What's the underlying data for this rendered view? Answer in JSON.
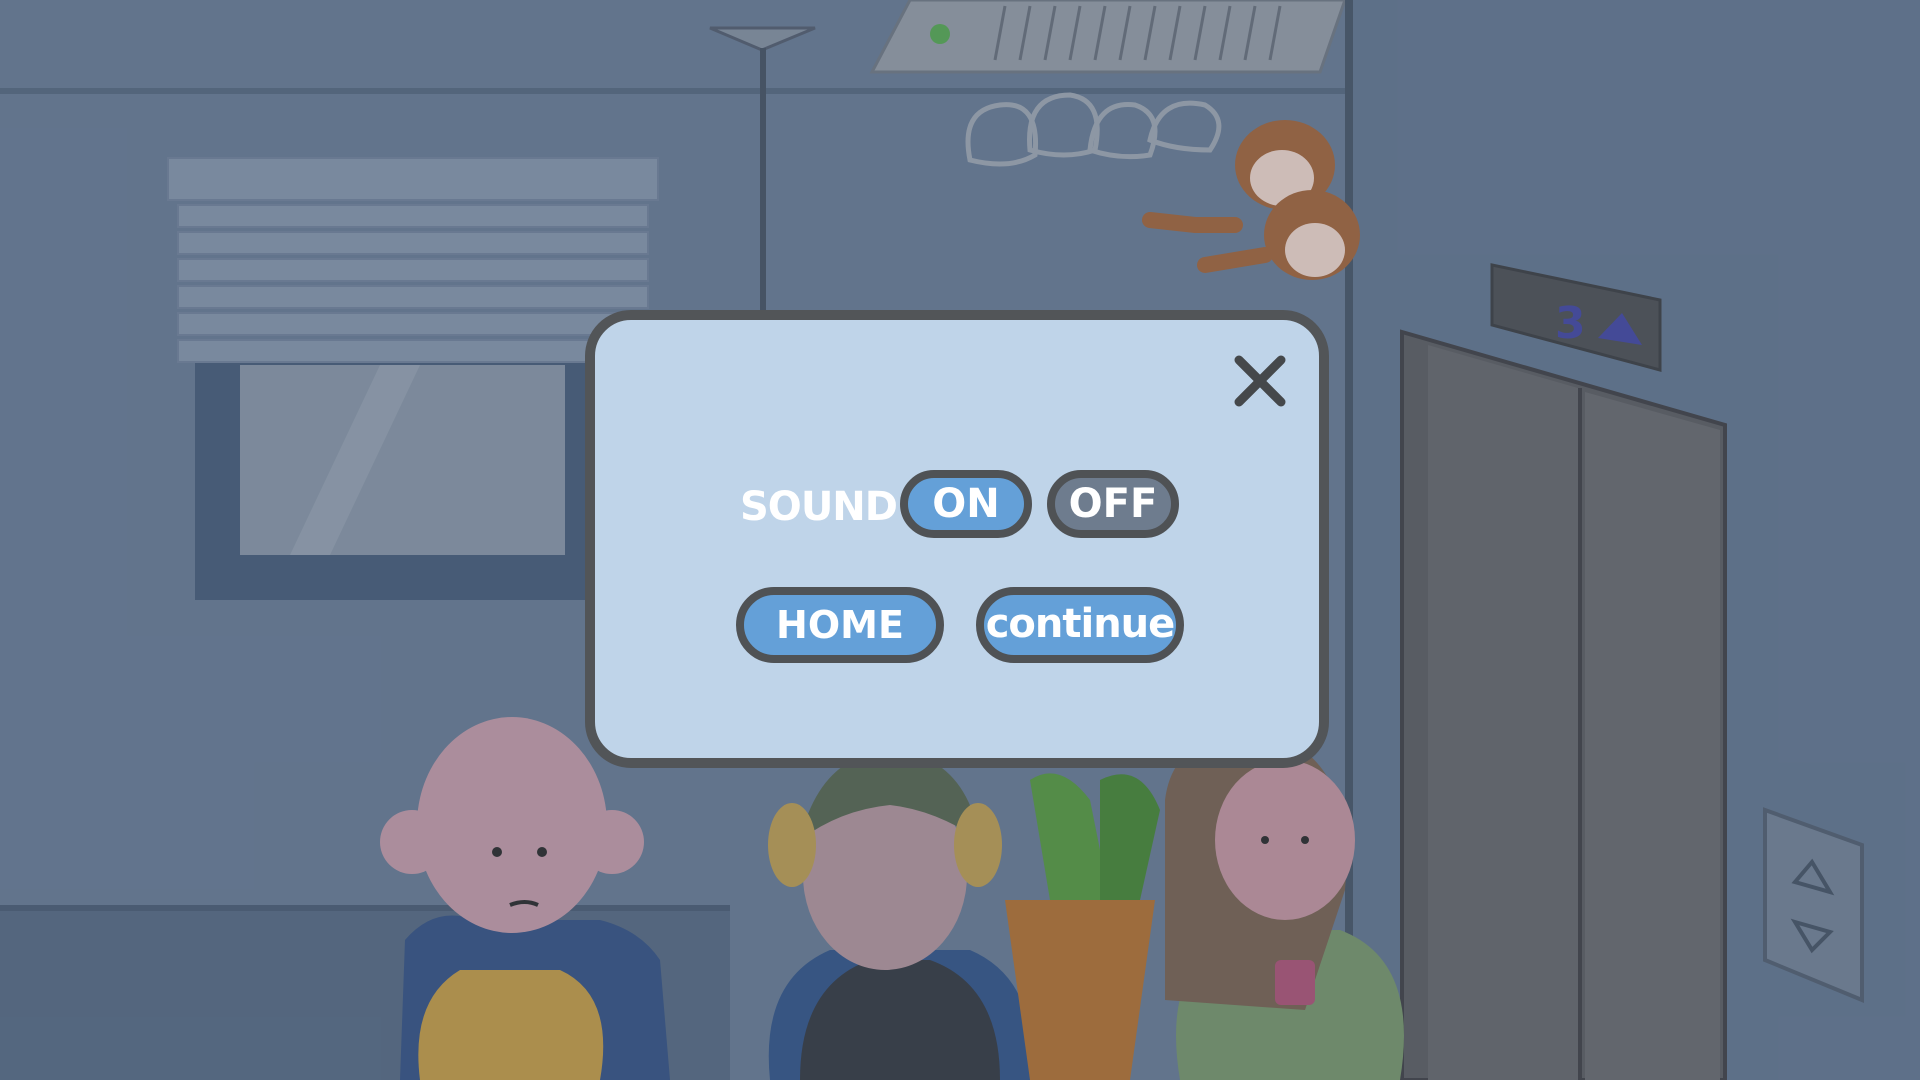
{
  "scene": {
    "elevator_floor_display": "3",
    "elevator_floor_arrow": "up-arrow-icon"
  },
  "dialog": {
    "close_icon": "close-icon",
    "sound_label": "SOUND",
    "sound_on_label": "ON",
    "sound_off_label": "OFF",
    "sound_state": "ON",
    "home_label": "HOME",
    "continue_label": "continue"
  },
  "colors": {
    "dialog_background": "#bfd4e9",
    "dialog_border": "#525558",
    "button_active": "#64a0d8",
    "button_inactive": "#6e7c8e"
  }
}
